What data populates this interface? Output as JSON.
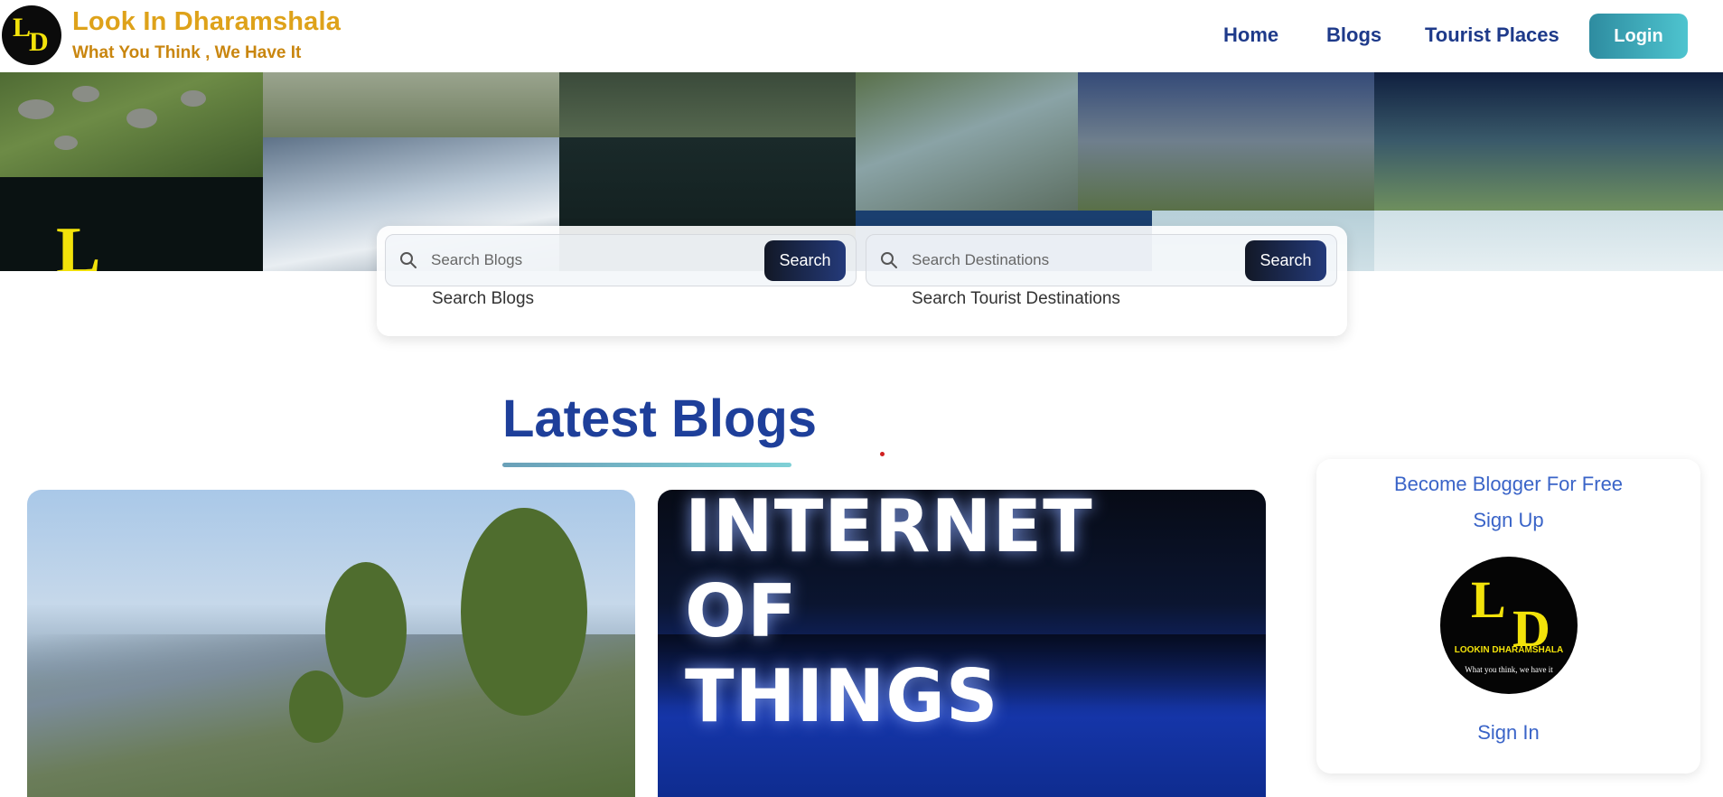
{
  "header": {
    "logo_text": "LD",
    "brand_title": "Look In Dharamshala",
    "brand_tagline": "What You Think , We Have It",
    "nav": [
      "Home",
      "Blogs",
      "Tourist Places"
    ],
    "login_label": "Login"
  },
  "search": {
    "blogs": {
      "placeholder": "Search Blogs",
      "button_label": "Search",
      "caption": "Search Blogs"
    },
    "destinations": {
      "placeholder": "Search Destinations",
      "button_label": "Search",
      "caption": "Search Tourist Destinations"
    }
  },
  "latest_blogs": {
    "title": "Latest Blogs",
    "cards": [
      {
        "image": "mountain-village-hillside"
      },
      {
        "image_text": [
          "INTERNET",
          "OF",
          "THINGS"
        ]
      }
    ]
  },
  "side_panel": {
    "become_blogger": "Become Blogger For Free",
    "sign_up": "Sign Up",
    "logo_caption": "LOOKIN DHARAMSHALA",
    "logo_tagline": "What you think, we have it",
    "sign_in": "Sign In"
  },
  "colors": {
    "brand": "#dea21a",
    "nav": "#1e3a8a",
    "accent_link": "#3a64c8",
    "title_blue": "#1e3f9a"
  }
}
